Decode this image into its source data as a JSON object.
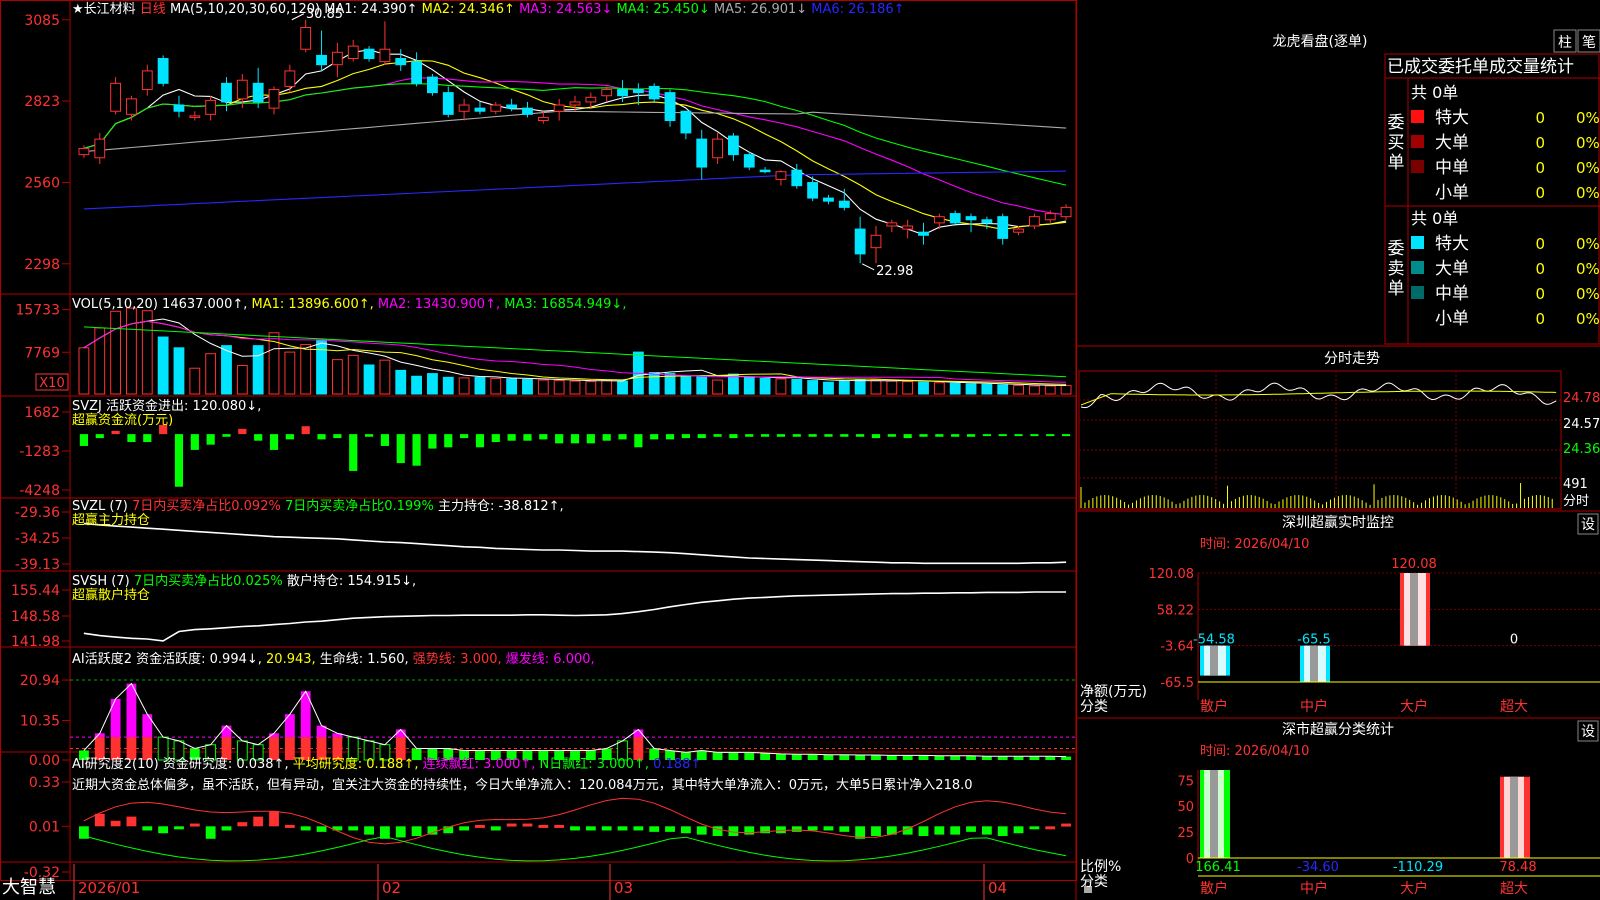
{
  "stock": {
    "name": "★长江材料",
    "period": "日线"
  },
  "colors": {
    "up": "#ff3232",
    "down": "#00e5ff",
    "frame": "#b00000",
    "yellow": "#ffff00",
    "magenta": "#ff00ff",
    "green": "#00ff00",
    "white": "#ffffff",
    "blue": "#2828ff",
    "gray": "#aaaaaa"
  },
  "chart_data": [
    {
      "type": "candlestick",
      "title": "MA(5,10,20,30,60,120)",
      "x_labels": [
        "2026/01",
        "02",
        "03",
        "04"
      ],
      "y_ticks": [
        "3085",
        "2823",
        "2560",
        "2298"
      ],
      "ylim": [
        2220,
        3110
      ],
      "annotations": [
        {
          "label": "30.85",
          "bar": 13,
          "price": 3085
        },
        {
          "label": "22.98",
          "bar": 49,
          "price": 2298
        }
      ],
      "legend": [
        {
          "text": "MA1: 24.390",
          "arrow": "↑",
          "color": "white"
        },
        {
          "text": "MA2: 24.346",
          "arrow": "↑",
          "color": "yellow"
        },
        {
          "text": "MA3: 24.563",
          "arrow": "↓",
          "color": "magenta"
        },
        {
          "text": "MA4: 25.450",
          "arrow": "↓",
          "color": "green"
        },
        {
          "text": "MA5: 26.901",
          "arrow": "↓",
          "color": "gray"
        },
        {
          "text": "MA6: 26.186",
          "arrow": "↑",
          "color": "blue"
        }
      ],
      "ohlc": [
        [
          2650,
          2680,
          2640,
          2670
        ],
        [
          2640,
          2720,
          2620,
          2700
        ],
        [
          2790,
          2900,
          2780,
          2880
        ],
        [
          2780,
          2840,
          2760,
          2830
        ],
        [
          2860,
          2940,
          2840,
          2920
        ],
        [
          2960,
          2970,
          2870,
          2880
        ],
        [
          2810,
          2840,
          2770,
          2790
        ],
        [
          2770,
          2790,
          2760,
          2775
        ],
        [
          2780,
          2840,
          2760,
          2825
        ],
        [
          2880,
          2900,
          2790,
          2820
        ],
        [
          2830,
          2910,
          2800,
          2890
        ],
        [
          2880,
          2930,
          2800,
          2820
        ],
        [
          2800,
          2870,
          2780,
          2860
        ],
        [
          2870,
          2940,
          2850,
          2920
        ],
        [
          2990,
          3085,
          2980,
          3060
        ],
        [
          2970,
          3050,
          2920,
          2940
        ],
        [
          2940,
          3010,
          2900,
          2980
        ],
        [
          2960,
          3020,
          2950,
          3000
        ],
        [
          2990,
          3000,
          2950,
          2960
        ],
        [
          2950,
          3080,
          2940,
          2990
        ],
        [
          2960,
          2990,
          2920,
          2940
        ],
        [
          2950,
          2980,
          2870,
          2880
        ],
        [
          2900,
          2910,
          2840,
          2850
        ],
        [
          2850,
          2870,
          2770,
          2780
        ],
        [
          2790,
          2830,
          2760,
          2810
        ],
        [
          2800,
          2820,
          2780,
          2790
        ],
        [
          2790,
          2820,
          2780,
          2810
        ],
        [
          2810,
          2830,
          2790,
          2800
        ],
        [
          2800,
          2820,
          2770,
          2780
        ],
        [
          2760,
          2790,
          2750,
          2770
        ],
        [
          2790,
          2830,
          2760,
          2810
        ],
        [
          2810,
          2840,
          2790,
          2820
        ],
        [
          2820,
          2850,
          2800,
          2835
        ],
        [
          2840,
          2870,
          2820,
          2860
        ],
        [
          2860,
          2890,
          2820,
          2840
        ],
        [
          2860,
          2880,
          2810,
          2850
        ],
        [
          2870,
          2880,
          2820,
          2830
        ],
        [
          2850,
          2860,
          2740,
          2760
        ],
        [
          2790,
          2790,
          2700,
          2720
        ],
        [
          2700,
          2730,
          2570,
          2610
        ],
        [
          2640,
          2720,
          2620,
          2700
        ],
        [
          2710,
          2720,
          2630,
          2650
        ],
        [
          2650,
          2660,
          2600,
          2610
        ],
        [
          2600,
          2610,
          2590,
          2595
        ],
        [
          2570,
          2600,
          2550,
          2595
        ],
        [
          2600,
          2620,
          2540,
          2550
        ],
        [
          2560,
          2580,
          2500,
          2510
        ],
        [
          2510,
          2520,
          2490,
          2500
        ],
        [
          2500,
          2540,
          2470,
          2480
        ],
        [
          2410,
          2450,
          2300,
          2330
        ],
        [
          2350,
          2420,
          2300,
          2390
        ],
        [
          2420,
          2440,
          2400,
          2430
        ],
        [
          2410,
          2440,
          2380,
          2420
        ],
        [
          2400,
          2430,
          2360,
          2390
        ],
        [
          2430,
          2460,
          2410,
          2450
        ],
        [
          2460,
          2470,
          2420,
          2430
        ],
        [
          2450,
          2460,
          2400,
          2440
        ],
        [
          2440,
          2450,
          2410,
          2430
        ],
        [
          2450,
          2460,
          2360,
          2380
        ],
        [
          2400,
          2420,
          2390,
          2410
        ],
        [
          2420,
          2460,
          2410,
          2450
        ],
        [
          2440,
          2470,
          2430,
          2460
        ],
        [
          2450,
          2490,
          2440,
          2480
        ]
      ]
    },
    {
      "type": "bar",
      "title": "VOL(5,10,20)",
      "y_ticks": [
        "15733",
        "7769"
      ],
      "multiplier_label": "X10",
      "legend": [
        {
          "text": "14637.000",
          "arrow": "↑",
          "color": "white"
        },
        {
          "text": "MA1: 13896.600",
          "arrow": "↑",
          "color": "yellow"
        },
        {
          "text": "MA2: 13430.900",
          "arrow": "↑",
          "color": "magenta"
        },
        {
          "text": "MA3: 16854.949",
          "arrow": "↓",
          "color": "green"
        }
      ],
      "values": [
        8600,
        12300,
        15400,
        16000,
        15500,
        10600,
        8600,
        4800,
        7500,
        9000,
        5300,
        9000,
        11400,
        7800,
        9200,
        10000,
        6400,
        7200,
        5400,
        6300,
        4400,
        3300,
        3800,
        3100,
        3000,
        3100,
        2900,
        2800,
        2700,
        2600,
        2500,
        2400,
        2300,
        2500,
        2400,
        7800,
        4000,
        3800,
        3400,
        3200,
        2600,
        3700,
        3200,
        2900,
        2800,
        2700,
        2500,
        2200,
        2400,
        2700,
        2600,
        2400,
        2300,
        2200,
        2100,
        2000,
        1900,
        1800,
        1700,
        1600,
        1500,
        1500,
        1600
      ]
    },
    {
      "type": "bar",
      "title": "SVZJ",
      "y_ticks": [
        "1682",
        "-1283",
        "-4248"
      ],
      "legend_line1": "活跃资金进出: 120.080↓,",
      "legend_line2": "超赢资金流(万元)",
      "values": [
        -900,
        -300,
        250,
        -600,
        -600,
        700,
        -4000,
        -1200,
        -800,
        -200,
        400,
        -500,
        -1200,
        -400,
        600,
        -400,
        -300,
        -2800,
        -200,
        -900,
        -2200,
        -2400,
        -1100,
        -1000,
        -300,
        -1000,
        -600,
        -500,
        -500,
        -400,
        -700,
        -700,
        -700,
        -500,
        -400,
        -1000,
        -400,
        -400,
        -300,
        -300,
        -200,
        -300,
        -200,
        -200,
        -200,
        -200,
        -200,
        -200,
        -200,
        -200,
        -300,
        -200,
        -300,
        -200,
        -200,
        -200,
        -200,
        -150,
        -150,
        -150,
        -100,
        -100,
        -100
      ]
    },
    {
      "type": "line",
      "title": "SVZL (7)",
      "y_ticks": [
        "-29.36",
        "-34.25",
        "-39.13"
      ],
      "legend": [
        "7日内买卖净占比0.092%",
        "7日内买卖净占比0.199%",
        "主力持仓: -38.812↑,"
      ],
      "legend_line2": "超赢主力持仓",
      "values": [
        -31.5,
        -31.8,
        -32.0,
        -32.2,
        -32.4,
        -32.6,
        -32.8,
        -33.0,
        -33.2,
        -33.4,
        -33.6,
        -33.8,
        -34.0,
        -34.1,
        -34.2,
        -34.3,
        -34.4,
        -34.6,
        -34.8,
        -35.0,
        -35.1,
        -35.3,
        -35.5,
        -35.7,
        -35.9,
        -36.0,
        -36.2,
        -36.3,
        -36.4,
        -36.5,
        -36.5,
        -36.6,
        -36.7,
        -36.7,
        -36.7,
        -36.8,
        -36.9,
        -37.0,
        -37.2,
        -37.4,
        -37.6,
        -37.8,
        -38.0,
        -38.1,
        -38.2,
        -38.3,
        -38.4,
        -38.5,
        -38.6,
        -38.7,
        -38.8,
        -38.9,
        -38.9,
        -39.0,
        -39.0,
        -39.0,
        -39.0,
        -39.0,
        -39.0,
        -39.0,
        -38.9,
        -38.9,
        -38.8
      ]
    },
    {
      "type": "line",
      "title": "SVSH (7)",
      "y_ticks": [
        "155.44",
        "148.58",
        "141.98"
      ],
      "legend": [
        "7日内买卖净占比0.025%",
        "散户持仓: 154.915↓,"
      ],
      "legend_line2": "超赢散户持仓",
      "values": [
        144.0,
        143.4,
        143.0,
        142.7,
        142.5,
        142.0,
        144.5,
        145.0,
        145.2,
        145.5,
        145.8,
        146.0,
        146.3,
        146.6,
        147.0,
        147.2,
        147.6,
        148.0,
        148.2,
        148.4,
        148.5,
        148.6,
        148.7,
        148.7,
        148.8,
        148.8,
        148.8,
        148.8,
        148.9,
        148.9,
        148.8,
        148.7,
        148.8,
        148.9,
        149.2,
        149.7,
        150.3,
        151.0,
        151.6,
        152.2,
        152.6,
        153.0,
        153.3,
        153.5,
        153.7,
        153.9,
        154.0,
        154.1,
        154.2,
        154.3,
        154.4,
        154.5,
        154.5,
        154.6,
        154.6,
        154.7,
        154.7,
        154.8,
        154.8,
        154.8,
        154.9,
        154.9,
        154.9
      ]
    },
    {
      "type": "bar",
      "title": "AI活跃度2",
      "y_ticks": [
        "20.94",
        "10.35",
        "0.00"
      ],
      "legend": [
        {
          "text": "资金活跃度: 0.994↓,",
          "color": "white"
        },
        {
          "text": "20.943,",
          "color": "yellow"
        },
        {
          "text": "生命线: 1.560,",
          "color": "white"
        },
        {
          "text": "强势线: 3.000,",
          "color": "red"
        },
        {
          "text": "爆发线: 6.000,",
          "color": "magenta"
        }
      ],
      "values": [
        2.5,
        7,
        16,
        20,
        12,
        6,
        5,
        3,
        4,
        9,
        5,
        4,
        7,
        12,
        18,
        9,
        7,
        6,
        5,
        4,
        8,
        3,
        3,
        3,
        2.5,
        2.5,
        2.5,
        2.5,
        2.5,
        2.5,
        2.5,
        2.5,
        2.5,
        3,
        5,
        8,
        3,
        2.5,
        2,
        2.5,
        2,
        2,
        2,
        1.8,
        1.6,
        1.5,
        1.5,
        1.4,
        1.4,
        1.3,
        1.3,
        1.2,
        1.2,
        1.2,
        1.1,
        1.1,
        1.1,
        1.0,
        1.0,
        1.0,
        1.0,
        1.0,
        0.9
      ]
    },
    {
      "type": "bar",
      "title": "AI研究度2(10)",
      "y_ticks": [
        "0.33",
        "0.01",
        "-0.32"
      ],
      "legend": [
        {
          "text": "资金研究度: 0.038↑,",
          "color": "white"
        },
        {
          "text": "平均研究度: 0.188↑,",
          "color": "yellow"
        },
        {
          "text": "连续飘红: 3.000↑,",
          "color": "magenta"
        },
        {
          "text": "N日飘红: 3.000↑,",
          "color": "green"
        },
        {
          "text": "0.188↑",
          "color": "blue"
        }
      ],
      "commentary": "近期大资金总体偏多，虽不活跃，但有异动，宜关注大资金的持续性，今日大单净流入：120.084万元，其中特大单净流入：0万元，大单5日累计净入218.0",
      "values": [
        -0.08,
        0.1,
        0.05,
        0.08,
        -0.02,
        -0.04,
        -0.01,
        0.03,
        -0.08,
        -0.02,
        0.04,
        0.08,
        0.12,
        0.02,
        -0.02,
        -0.03,
        -0.02,
        -0.02,
        -0.05,
        -0.08,
        -0.07,
        -0.06,
        -0.05,
        -0.04,
        -0.02,
        0.02,
        -0.02,
        0.03,
        0.03,
        0.02,
        0.02,
        -0.02,
        -0.02,
        -0.02,
        -0.02,
        -0.02,
        -0.03,
        -0.03,
        -0.04,
        -0.05,
        -0.06,
        -0.06,
        -0.05,
        -0.04,
        -0.04,
        -0.03,
        -0.02,
        -0.02,
        -0.03,
        -0.08,
        -0.06,
        -0.05,
        -0.05,
        -0.06,
        -0.05,
        -0.05,
        -0.03,
        -0.05,
        -0.06,
        -0.04,
        -0.01,
        0.01,
        0.03
      ]
    },
    {
      "type": "bar",
      "title": "深圳超赢实时监控",
      "time_label": "时间: 2026/04/10",
      "y_ticks": [
        "120.08",
        "58.22",
        "-3.64",
        "-65.5"
      ],
      "ylim": [
        -65.5,
        120.08
      ],
      "categories": [
        "散户",
        "中户",
        "大户",
        "超大"
      ],
      "values": [
        -54.58,
        -65.5,
        120.08,
        0
      ],
      "value_labels": [
        "-54.58",
        "-65.5",
        "120.08",
        "0"
      ],
      "left_label1": "净额(万元)",
      "left_label2": "分类"
    },
    {
      "type": "bar",
      "title": "深市超赢分类统计",
      "time_label": "时间: 2026/04/10",
      "y_ticks": [
        "75",
        "50",
        "25",
        "0"
      ],
      "ylim": [
        0,
        85
      ],
      "categories": [
        "散户",
        "中户",
        "大户",
        "超大"
      ],
      "values": [
        166.41,
        -34.6,
        -110.29,
        78.48
      ],
      "value_labels": [
        "166.41",
        "-34.60",
        "-110.29",
        "78.48"
      ],
      "left_label1": "比例%",
      "left_label2": "分类"
    }
  ],
  "right_panel": {
    "top_title": "龙虎看盘(逐单)",
    "btn_zhu": "柱",
    "btn_bi": "笔",
    "stats_title": "已成交委托单成交量统计",
    "buy": {
      "label_chars": [
        "委",
        "买",
        "单"
      ],
      "total": "共 0单",
      "rows": [
        {
          "name": "特大",
          "val": "0",
          "pct": "0%",
          "color": "#ff1010"
        },
        {
          "name": "大单",
          "val": "0",
          "pct": "0%",
          "color": "#a00000"
        },
        {
          "name": "中单",
          "val": "0",
          "pct": "0%",
          "color": "#7a0000"
        },
        {
          "name": "小单",
          "val": "0",
          "pct": "0%",
          "color": ""
        }
      ]
    },
    "sell": {
      "label_chars": [
        "委",
        "卖",
        "单"
      ],
      "total": "共 0单",
      "rows": [
        {
          "name": "特大",
          "val": "0",
          "pct": "0%",
          "color": "#00e5ff"
        },
        {
          "name": "大单",
          "val": "0",
          "pct": "0%",
          "color": "#008c8c"
        },
        {
          "name": "中单",
          "val": "0",
          "pct": "0%",
          "color": "#006a6a"
        },
        {
          "name": "小单",
          "val": "0",
          "pct": "0%",
          "color": ""
        }
      ]
    },
    "intraday": {
      "title": "分时走势",
      "y_labels": [
        "24.78",
        "24.57",
        "24.36"
      ],
      "vol_label": "491",
      "bottom_label": "分时"
    },
    "settings_btn": "设"
  },
  "footer": {
    "brand": "大智慧"
  }
}
